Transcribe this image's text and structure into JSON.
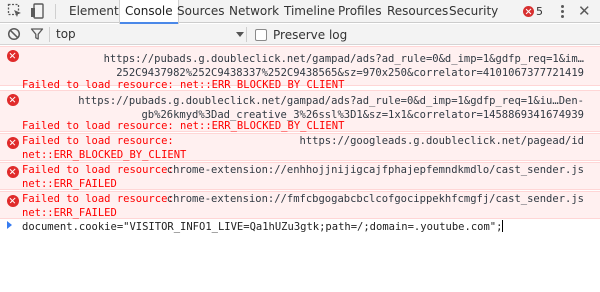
{
  "toolbar": {
    "inspect_icon": "inspect-element-icon",
    "device_icon": "device-mode-icon",
    "tabs": [
      "Elements",
      "Console",
      "Sources",
      "Network",
      "Timeline",
      "Profiles",
      "Resources",
      "Security"
    ],
    "active_tab": "Console",
    "error_count": "5",
    "more_icon": "kebab-menu-icon",
    "close_label": "✕"
  },
  "filterbar": {
    "clear_icon": "clear-console-icon",
    "filter_icon": "filter-icon",
    "context": "top",
    "preserve_log_label": "Preserve log",
    "preserve_log_checked": false
  },
  "messages": [
    {
      "url_line1": "https://pubads.g.doubleclick.net/gampad/ads?ad_rule=0&d_imp=1&gdfp_req=1&im…",
      "url_line2": "252C9437982%252C9438337%252C9438565&sz=970x250&correlator=4101067377721419",
      "error": "Failed to load resource: net::ERR_BLOCKED_BY_CLIENT"
    },
    {
      "url_line1": "https://pubads.g.doubleclick.net/gampad/ads?ad_rule=0&d_imp=1&gdfp_req=1&iu…Den-",
      "url_line2": "gb%26kmyd%3Dad_creative_3%26ssl%3D1&sz=1x1&correlator=1458869341674939",
      "error": "Failed to load resource: net::ERR_BLOCKED_BY_CLIENT"
    },
    {
      "error_part1": "Failed to load resource:",
      "url": "https://googleads.g.doubleclick.net/pagead/id",
      "error_part2": "net::ERR_BLOCKED_BY_CLIENT"
    },
    {
      "error_part1": "Failed to load resource:",
      "url": "chrome-extension://enhhojjnijigcajfphajepfemndkmdlo/cast_sender.js",
      "error_part2": "net::ERR_FAILED"
    },
    {
      "error_part1": "Failed to load resource:",
      "url": "chrome-extension://fmfcbgogabcbclcofgocippekhfcmgfj/cast_sender.js",
      "error_part2": "net::ERR_FAILED"
    }
  ],
  "prompt": {
    "input": "document.cookie=\"VISITOR_INFO1_LIVE=Qa1hUZu3gtk;path=/;domain=.youtube.com\";"
  },
  "colors": {
    "error_text": "#ff0000",
    "error_bg": "#fff0f0",
    "accent": "#4a88e8"
  }
}
